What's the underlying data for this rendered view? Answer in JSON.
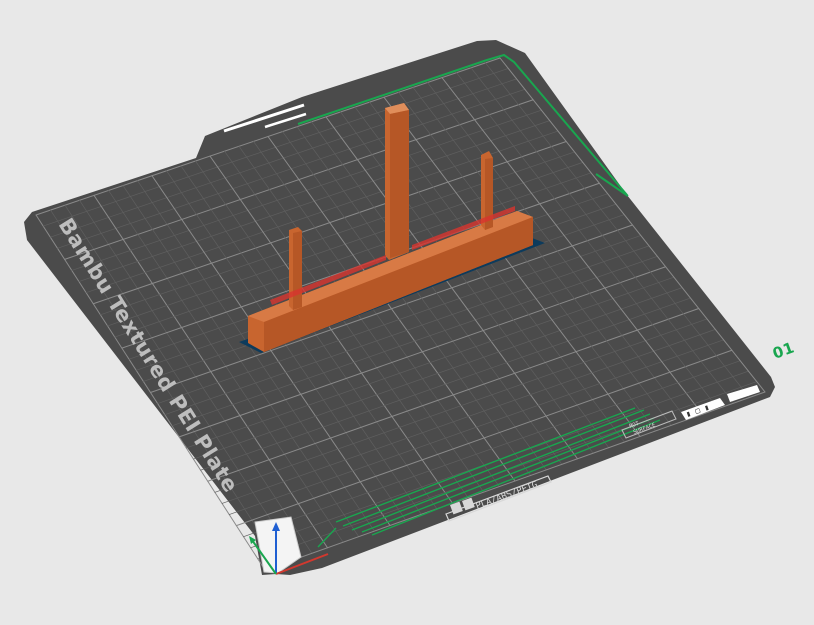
{
  "plate": {
    "brand_label": "Bambu Textured PEI Plate",
    "plate_number": "01",
    "filament_label": "PLA/ABS/PETG",
    "surface_label_line1": "HOT",
    "surface_label_line2": "SURFACE"
  },
  "colors": {
    "background": "#e8e8e8",
    "plate": "#4b4b4b",
    "grid_minor": "#5c5c5c",
    "grid_major": "#8e8e8e",
    "accent_green": "#19a64f",
    "model_orange": "#c8652f",
    "model_shadow": "#0d3b5c"
  },
  "icons": [
    "axis-gizmo-icon",
    "plate-icons",
    "hot-surface-warning-icon"
  ]
}
